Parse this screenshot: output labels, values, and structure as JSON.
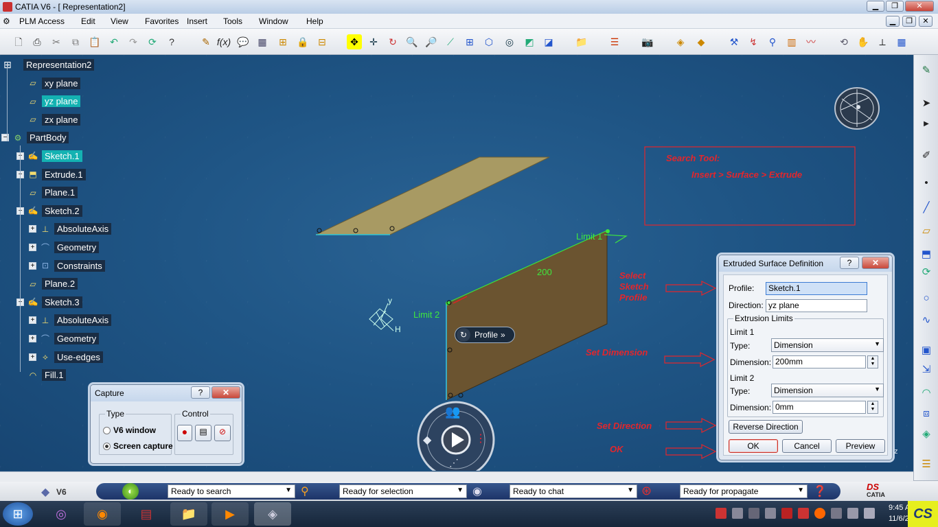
{
  "window": {
    "title": "CATIA V6 - [ Representation2]"
  },
  "menu": [
    "PLM Access",
    "Edit",
    "View",
    "Favorites",
    "Insert",
    "Tools",
    "Window",
    "Help"
  ],
  "tree": {
    "root": "Representation2",
    "items": [
      {
        "label": "xy plane",
        "icon": "plane-icon",
        "level": 1,
        "selected": false
      },
      {
        "label": "yz plane",
        "icon": "plane-icon",
        "level": 1,
        "selected": true
      },
      {
        "label": "zx plane",
        "icon": "plane-icon",
        "level": 1,
        "selected": false
      },
      {
        "label": "PartBody",
        "icon": "partbody-gear-icon",
        "level": 0,
        "selected": false
      },
      {
        "label": "Sketch.1",
        "icon": "sketch-icon",
        "level": 1,
        "selected": true
      },
      {
        "label": "Extrude.1",
        "icon": "extrude-icon",
        "level": 1,
        "selected": false
      },
      {
        "label": "Plane.1",
        "icon": "plane-icon",
        "level": 1,
        "selected": false
      },
      {
        "label": "Sketch.2",
        "icon": "sketch-icon",
        "level": 1,
        "selected": false
      },
      {
        "label": "AbsoluteAxis",
        "icon": "axis-icon",
        "level": 2,
        "selected": false
      },
      {
        "label": "Geometry",
        "icon": "geometry-icon",
        "level": 2,
        "selected": false
      },
      {
        "label": "Constraints",
        "icon": "constraints-icon",
        "level": 2,
        "selected": false
      },
      {
        "label": "Plane.2",
        "icon": "plane-icon",
        "level": 1,
        "selected": false
      },
      {
        "label": "Sketch.3",
        "icon": "sketch-icon",
        "level": 1,
        "selected": false
      },
      {
        "label": "AbsoluteAxis",
        "icon": "axis-icon",
        "level": 2,
        "selected": false
      },
      {
        "label": "Geometry",
        "icon": "geometry-icon",
        "level": 2,
        "selected": false
      },
      {
        "label": "Use-edges",
        "icon": "use-edges-icon",
        "level": 2,
        "selected": false
      },
      {
        "label": "Fill.1",
        "icon": "fill-icon",
        "level": 1,
        "selected": false
      }
    ]
  },
  "annotations": {
    "search_title": "Search Tool:",
    "search_path": "Insert > Surface > Extrude",
    "select_sketch": [
      "Select",
      "Sketch",
      "Profile"
    ],
    "set_dimension": "Set Dimension",
    "set_direction": "Set Direction",
    "ok": "OK"
  },
  "viewport": {
    "limit1": "Limit 1",
    "limit2": "Limit 2",
    "dim200": "200",
    "profile_btn": "Profile",
    "axis_y": "y",
    "axis_h": "H"
  },
  "extrude_dialog": {
    "title": "Extruded Surface Definition",
    "help": "?",
    "close": "✕",
    "profile_label": "Profile:",
    "profile_value": "Sketch.1",
    "direction_label": "Direction:",
    "direction_value": "yz plane",
    "limits_group": "Extrusion Limits",
    "limit1": {
      "title": "Limit 1",
      "type_label": "Type:",
      "type_value": "Dimension",
      "dim_label": "Dimension:",
      "dim_value": "200mm"
    },
    "limit2": {
      "title": "Limit 2",
      "type_label": "Type:",
      "type_value": "Dimension",
      "dim_label": "Dimension:",
      "dim_value": "0mm"
    },
    "reverse": "Reverse Direction",
    "ok": "OK",
    "cancel": "Cancel",
    "preview": "Preview"
  },
  "capture_dialog": {
    "title": "Capture",
    "help": "?",
    "close": "✕",
    "type_group": "Type",
    "control_group": "Control",
    "opt1": "V6 window",
    "opt2": "Screen capture",
    "selected": "Screen capture"
  },
  "status": {
    "v6": "V6",
    "search": "Ready to search",
    "selection": "Ready for selection",
    "chat": "Ready to chat",
    "propagate": "Ready for propagate",
    "brand": "CATIA"
  },
  "taskbar": {
    "time": "9:45 A",
    "date": "11/6/2",
    "cs_logo": "CS"
  },
  "colors": {
    "viewport_bg": "#1f5585",
    "surface_face": "#6b5430",
    "top_surface": "#a99a63",
    "annotation_red": "#e3262c",
    "dimension_green": "#3ee83e",
    "selected_tree": "#14b2b2"
  }
}
